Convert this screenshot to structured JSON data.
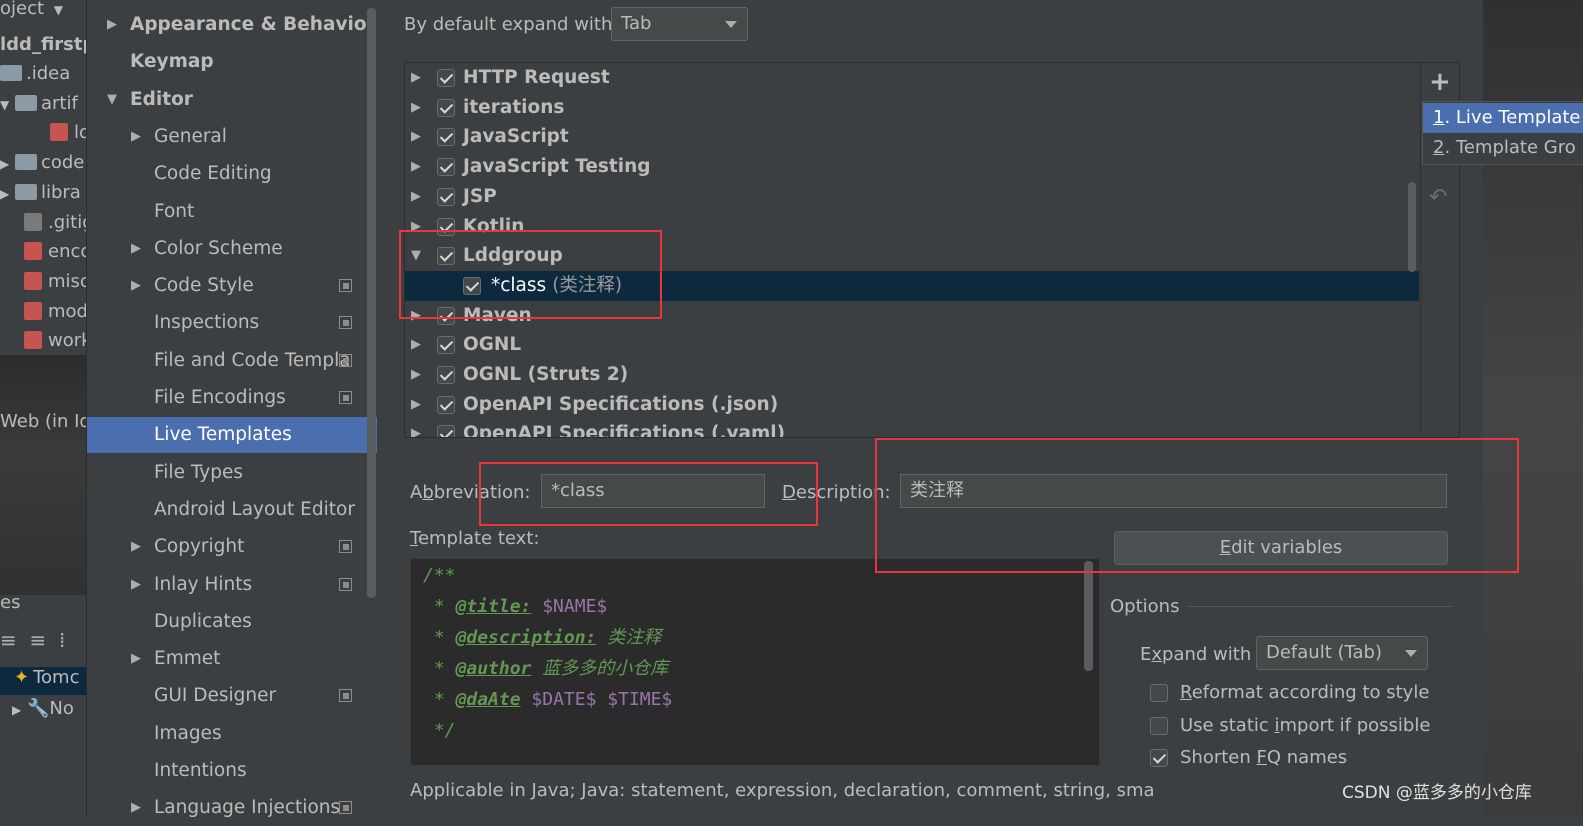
{
  "project_panel": {
    "header": "oject",
    "items": [
      {
        "label": "ldd_firstpr",
        "kind": "root"
      },
      {
        "label": ".idea",
        "kind": "folder"
      },
      {
        "label": "artif",
        "kind": "folder"
      },
      {
        "label": "lo",
        "kind": "file"
      },
      {
        "label": "code",
        "kind": "folder"
      },
      {
        "label": "libra",
        "kind": "folder"
      },
      {
        "label": ".gitig",
        "kind": "file"
      },
      {
        "label": "enco",
        "kind": "file"
      },
      {
        "label": "misc",
        "kind": "file"
      },
      {
        "label": "mod",
        "kind": "file"
      },
      {
        "label": "work",
        "kind": "file"
      }
    ],
    "web_label": "Web (in Id",
    "services_label": "es",
    "tomcat_label": "Tomc",
    "not_label": "No"
  },
  "settings_tree": {
    "items": [
      {
        "label": "Appearance & Behavior",
        "bold": true,
        "arrow": "right",
        "level": 0
      },
      {
        "label": "Keymap",
        "bold": true,
        "arrow": "",
        "level": 0
      },
      {
        "label": "Editor",
        "bold": true,
        "arrow": "down",
        "level": 0
      },
      {
        "label": "General",
        "bold": false,
        "arrow": "right",
        "level": 1
      },
      {
        "label": "Code Editing",
        "bold": false,
        "arrow": "",
        "level": 1
      },
      {
        "label": "Font",
        "bold": false,
        "arrow": "",
        "level": 1
      },
      {
        "label": "Color Scheme",
        "bold": false,
        "arrow": "right",
        "level": 1
      },
      {
        "label": "Code Style",
        "bold": false,
        "arrow": "right",
        "level": 1,
        "page_icon": true
      },
      {
        "label": "Inspections",
        "bold": false,
        "arrow": "",
        "level": 1,
        "page_icon": true
      },
      {
        "label": "File and Code Templa",
        "bold": false,
        "arrow": "",
        "level": 1,
        "page_icon": true
      },
      {
        "label": "File Encodings",
        "bold": false,
        "arrow": "",
        "level": 1,
        "page_icon": true
      },
      {
        "label": "Live Templates",
        "bold": false,
        "arrow": "",
        "level": 1,
        "selected": true
      },
      {
        "label": "File Types",
        "bold": false,
        "arrow": "",
        "level": 1
      },
      {
        "label": "Android Layout Editor",
        "bold": false,
        "arrow": "",
        "level": 1
      },
      {
        "label": "Copyright",
        "bold": false,
        "arrow": "right",
        "level": 1,
        "page_icon": true
      },
      {
        "label": "Inlay Hints",
        "bold": false,
        "arrow": "right",
        "level": 1,
        "page_icon": true
      },
      {
        "label": "Duplicates",
        "bold": false,
        "arrow": "",
        "level": 1
      },
      {
        "label": "Emmet",
        "bold": false,
        "arrow": "right",
        "level": 1
      },
      {
        "label": "GUI Designer",
        "bold": false,
        "arrow": "",
        "level": 1,
        "page_icon": true
      },
      {
        "label": "Images",
        "bold": false,
        "arrow": "",
        "level": 1
      },
      {
        "label": "Intentions",
        "bold": false,
        "arrow": "",
        "level": 1
      },
      {
        "label": "Language Injections",
        "bold": false,
        "arrow": "right",
        "level": 1,
        "page_icon": true
      }
    ]
  },
  "expand_default": {
    "label": "By default expand with",
    "value": "Tab"
  },
  "template_groups": [
    {
      "label": "HTTP Request",
      "expanded": false,
      "checked": true
    },
    {
      "label": "iterations",
      "expanded": false,
      "checked": true
    },
    {
      "label": "JavaScript",
      "expanded": false,
      "checked": true
    },
    {
      "label": "JavaScript Testing",
      "expanded": false,
      "checked": true
    },
    {
      "label": "JSP",
      "expanded": false,
      "checked": true
    },
    {
      "label": "Kotlin",
      "expanded": false,
      "checked": true
    },
    {
      "label": "Lddgroup",
      "expanded": true,
      "checked": true
    },
    {
      "label": "*class",
      "child": true,
      "checked": true,
      "desc": "(类注释)"
    },
    {
      "label": "Maven",
      "expanded": false,
      "checked": true
    },
    {
      "label": "OGNL",
      "expanded": false,
      "checked": true
    },
    {
      "label": "OGNL (Struts 2)",
      "expanded": false,
      "checked": true
    },
    {
      "label": "OpenAPI Specifications (.json)",
      "expanded": false,
      "checked": true
    },
    {
      "label": "OpenAPI Specifications (.yaml)",
      "expanded": false,
      "checked": true
    }
  ],
  "toolbar": {
    "add": "+",
    "undo": "↶"
  },
  "add_popup": {
    "items": [
      {
        "num": "1",
        "label": ". Live Template"
      },
      {
        "num": "2",
        "label": ". Template Gro"
      }
    ]
  },
  "abbreviation": {
    "label_pre": "A",
    "label_u": "b",
    "label_post": "breviation:",
    "value": "*class"
  },
  "description": {
    "label_u": "D",
    "label_post": "escription:",
    "value": "类注释"
  },
  "template_text_label": {
    "u": "T",
    "rest": "emplate text:"
  },
  "edit_variables": {
    "u": "E",
    "rest": "dit variables"
  },
  "template_code": {
    "line1": "/**",
    "line2_prefix": " * ",
    "line2_tag": "@title:",
    "line2_var": "$NAME$",
    "line3_prefix": " * ",
    "line3_tag": "@description:",
    "line3_text": "类注释",
    "line4_prefix": " * ",
    "line4_tag": "@author",
    "line4_text": "蓝多多的小仓库",
    "line5_prefix": " * ",
    "line5_tag": "@daAte",
    "line5_var": "$DATE$ $TIME$",
    "line6": " */"
  },
  "options": {
    "title": "Options",
    "expand_with_label_pre": "E",
    "expand_with_label_u": "x",
    "expand_with_label_post": "pand with",
    "expand_with_value": "Default (Tab)",
    "reformat": {
      "u": "R",
      "rest": "eformat according to style",
      "checked": false
    },
    "static_import": {
      "pre": "Use static ",
      "u": "i",
      "rest": "mport if possible",
      "checked": false
    },
    "shorten_fq": {
      "pre": "Shorten ",
      "u": "F",
      "rest": "Q names",
      "checked": true
    }
  },
  "applicable": "Applicable in Java; Java: statement, expression, declaration, comment, string, sma",
  "watermark": "CSDN @蓝多多的小仓库",
  "colors": {
    "selection": "#4b6eaf",
    "child_selection": "#0d293e",
    "annotation": "#e8363a"
  }
}
